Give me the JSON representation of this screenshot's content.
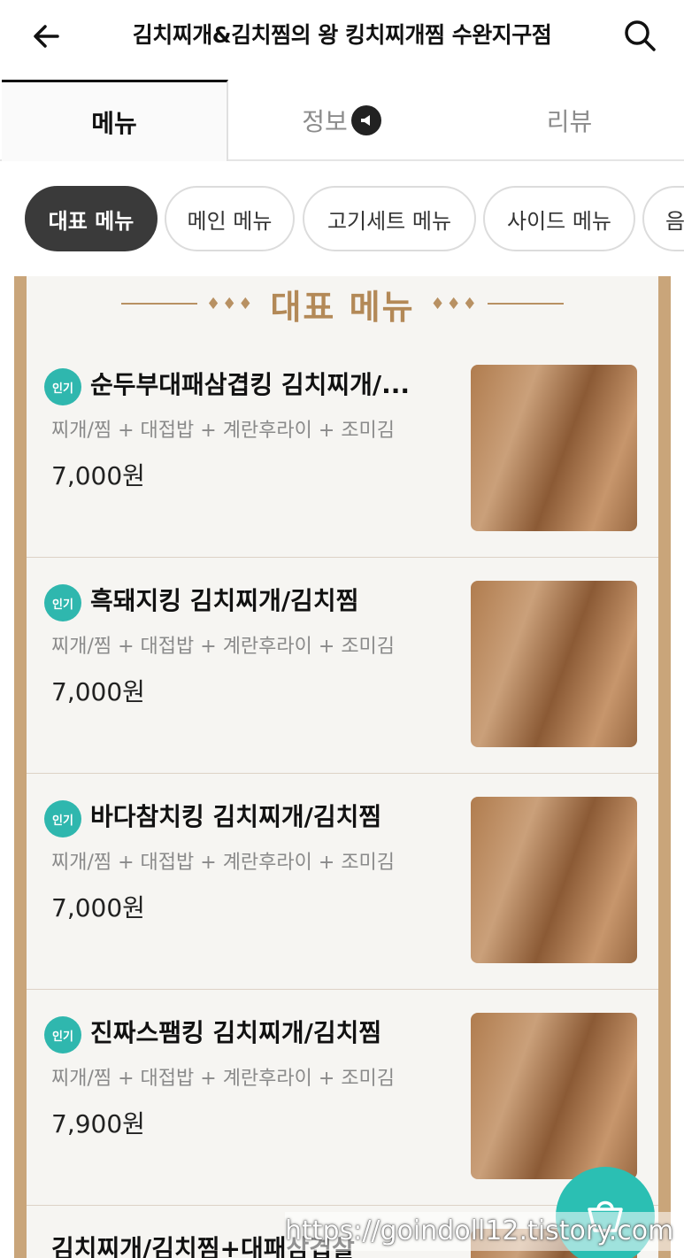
{
  "header": {
    "title": "김치찌개&김치찜의 왕 킹치찌개찜 수완지구점",
    "back_icon": "arrow-left-icon",
    "search_icon": "search-icon"
  },
  "tabs": [
    {
      "label": "메뉴",
      "active": true
    },
    {
      "label": "정보",
      "active": false,
      "icon": "megaphone-icon"
    },
    {
      "label": "리뷰",
      "active": false
    }
  ],
  "categories": [
    {
      "label": "대표 메뉴",
      "active": true
    },
    {
      "label": "메인 메뉴",
      "active": false
    },
    {
      "label": "고기세트 메뉴",
      "active": false
    },
    {
      "label": "사이드 메뉴",
      "active": false
    },
    {
      "label": "음",
      "active": false
    }
  ],
  "section": {
    "title": "대표 메뉴",
    "decor": "♦♦♦"
  },
  "items": [
    {
      "badge": "인기",
      "name": "순두부대패삼겹킹 김치찌개/...",
      "desc": "찌개/찜 + 대접밥 + 계란후라이 + 조미김",
      "price": "7,000원"
    },
    {
      "badge": "인기",
      "name": "흑돼지킹 김치찌개/김치찜",
      "desc": "찌개/찜 + 대접밥 + 계란후라이 + 조미김",
      "price": "7,000원"
    },
    {
      "badge": "인기",
      "name": "바다참치킹 김치찌개/김치찜",
      "desc": "찌개/찜 + 대접밥 + 계란후라이 + 조미김",
      "price": "7,000원"
    },
    {
      "badge": "인기",
      "name": "진짜스팸킹 김치찌개/김치찜",
      "desc": "찌개/찜 + 대접밥 + 계란후라이 + 조미김",
      "price": "7,900원"
    },
    {
      "badge": "",
      "name": "김치찌개/김치찜+대패삼겹살",
      "desc": "",
      "price": ""
    }
  ],
  "cart": {
    "icon": "cart-icon"
  },
  "watermark": "https://goindoll12.tistory.com",
  "colors": {
    "accent": "#2bbfb3",
    "frame": "#c9a57a",
    "section_title": "#b38957"
  }
}
